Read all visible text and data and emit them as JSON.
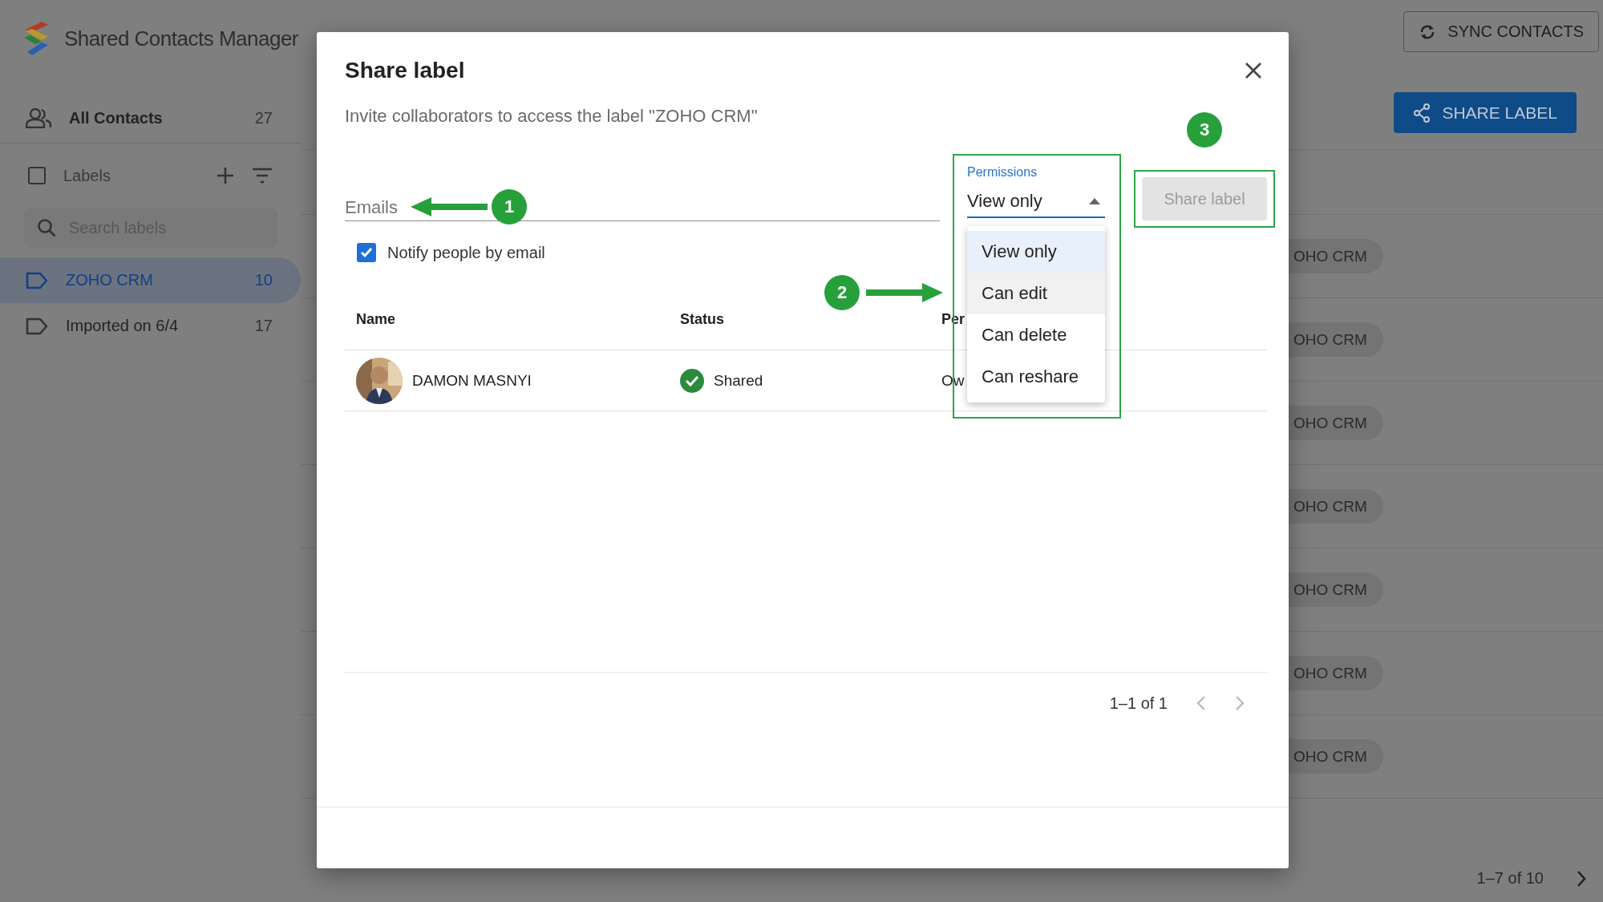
{
  "app": {
    "title": "Shared Contacts Manager"
  },
  "toolbar": {
    "sync_button": "SYNC CONTACTS",
    "share_button": "SHARE LABEL"
  },
  "sidebar": {
    "all_contacts": {
      "label": "All Contacts",
      "count": "27"
    },
    "labels_header": {
      "label": "Labels",
      "checked": false
    },
    "search": {
      "placeholder": "Search labels"
    },
    "labels": [
      {
        "name": "ZOHO CRM",
        "count": "10",
        "selected": true
      },
      {
        "name": "Imported on 6/4",
        "count": "17",
        "selected": false
      }
    ]
  },
  "contact_rows": [
    {
      "label_chip": "OHO CRM"
    },
    {
      "label_chip": "OHO CRM"
    },
    {
      "label_chip": "OHO CRM"
    },
    {
      "label_chip": "OHO CRM"
    },
    {
      "label_chip": "OHO CRM"
    },
    {
      "label_chip": "OHO CRM"
    },
    {
      "label_chip": "OHO CRM"
    }
  ],
  "pagination": "1–7 of 10",
  "dialog": {
    "title": "Share label",
    "subtitle": "Invite collaborators to access the label \"ZOHO CRM\"",
    "emails": {
      "placeholder": "Emails"
    },
    "notify": {
      "label": "Notify people by email",
      "checked": true
    },
    "permissions": {
      "label": "Permissions",
      "value": "View only",
      "expanded": true,
      "options": [
        {
          "label": "View only",
          "selected": true,
          "hovered": false
        },
        {
          "label": "Can edit",
          "selected": false,
          "hovered": true
        },
        {
          "label": "Can delete",
          "selected": false,
          "hovered": false
        },
        {
          "label": "Can reshare",
          "selected": false,
          "hovered": false
        }
      ]
    },
    "share_button": {
      "label": "Share label",
      "disabled": true
    },
    "table": {
      "columns": [
        "Name",
        "Status",
        "Per"
      ],
      "rows": [
        {
          "name": "DAMON MASNYI",
          "status": "Shared",
          "permission": "Ow"
        }
      ]
    },
    "pagination": "1–1 of 1",
    "annotations": [
      {
        "number": "1"
      },
      {
        "number": "2"
      },
      {
        "number": "3"
      }
    ]
  }
}
